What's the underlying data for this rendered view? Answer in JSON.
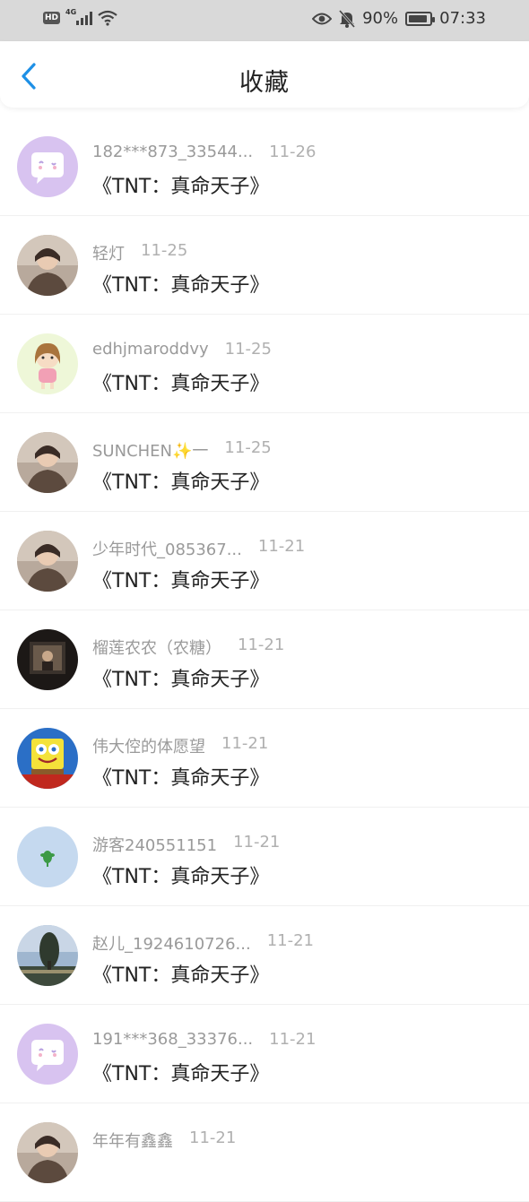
{
  "status_bar": {
    "hd": "HD",
    "network": "4G",
    "battery": "90%",
    "battery_level": 0.9,
    "time": "07:33"
  },
  "header": {
    "title": "收藏",
    "back_icon": "chevron-left-icon",
    "accent_color": "#1e90e6"
  },
  "favorites": [
    {
      "user": "182***873_33544...",
      "date": "11-26",
      "work": "《TNT：真命天子》",
      "avatar": "default-chat-bubble"
    },
    {
      "user": "轻灯",
      "date": "11-25",
      "work": "《TNT：真命天子》",
      "avatar": "photo-person"
    },
    {
      "user": "edhjmaroddvy",
      "date": "11-25",
      "work": "《TNT：真命天子》",
      "avatar": "cartoon-girl"
    },
    {
      "user": "SUNCHEN✨一",
      "date": "11-25",
      "work": "《TNT：真命天子》",
      "avatar": "photo-person"
    },
    {
      "user": "少年时代_085367...",
      "date": "11-21",
      "work": "《TNT：真命天子》",
      "avatar": "photo-person"
    },
    {
      "user": "榴莲农农（农糖）",
      "date": "11-21",
      "work": "《TNT：真命天子》",
      "avatar": "dark-photo"
    },
    {
      "user": "伟大倥的体愿望",
      "date": "11-21",
      "work": "《TNT：真命天子》",
      "avatar": "cartoon-sponge"
    },
    {
      "user": "游客240551151",
      "date": "11-21",
      "work": "《TNT：真命天子》",
      "avatar": "blue-plant"
    },
    {
      "user": "赵儿_1924610726...",
      "date": "11-21",
      "work": "《TNT：真命天子》",
      "avatar": "landscape-tree"
    },
    {
      "user": "191***368_33376...",
      "date": "11-21",
      "work": "《TNT：真命天子》",
      "avatar": "default-chat-bubble"
    },
    {
      "user": "年年有鑫鑫",
      "date": "11-21",
      "work": "",
      "avatar": "photo-person"
    }
  ]
}
